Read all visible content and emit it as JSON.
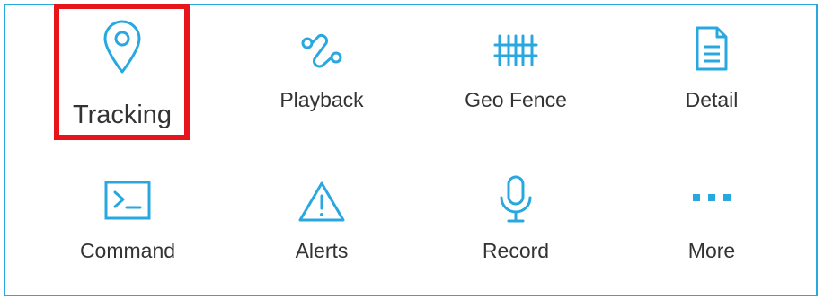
{
  "menu": {
    "items": [
      {
        "label": "Tracking",
        "icon": "map-pin-icon"
      },
      {
        "label": "Playback",
        "icon": "route-path-icon"
      },
      {
        "label": "Geo Fence",
        "icon": "fence-icon"
      },
      {
        "label": "Detail",
        "icon": "document-icon"
      },
      {
        "label": "Command",
        "icon": "terminal-icon"
      },
      {
        "label": "Alerts",
        "icon": "warning-triangle-icon"
      },
      {
        "label": "Record",
        "icon": "microphone-icon"
      },
      {
        "label": "More",
        "icon": "more-dots-icon"
      }
    ],
    "selected_index": 0
  },
  "colors": {
    "accent": "#29a8e0",
    "highlight": "#e8141b",
    "text": "#333333"
  }
}
